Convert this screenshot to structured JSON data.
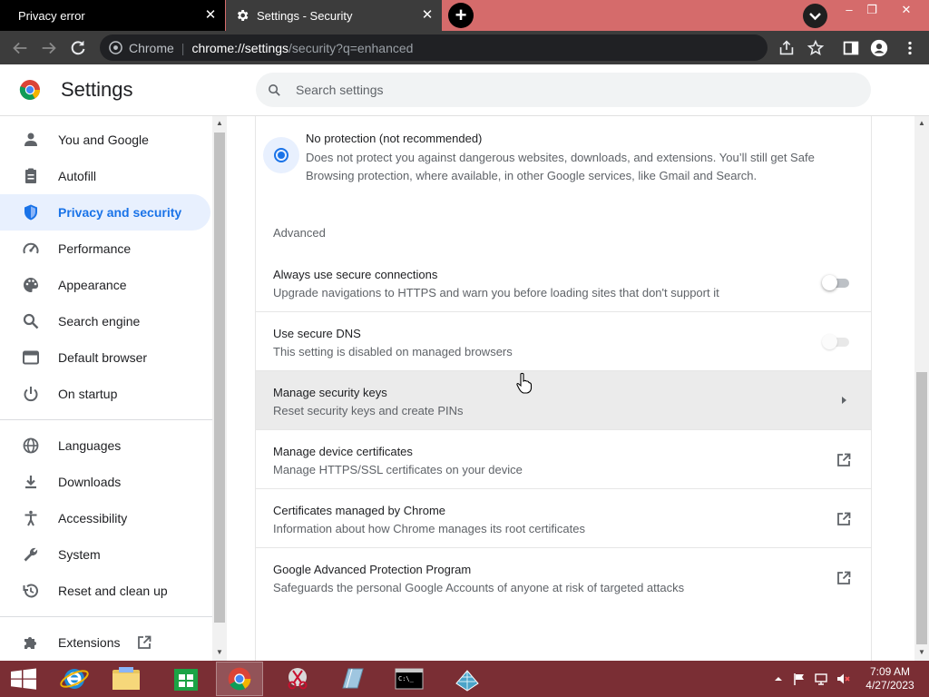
{
  "browser": {
    "tabs": [
      {
        "title": "Privacy error",
        "active": false
      },
      {
        "title": "Settings - Security",
        "active": true
      }
    ],
    "omnibox": {
      "chip": "Chrome",
      "url_host": "chrome://settings",
      "url_path": "/security?q=enhanced"
    },
    "window_controls": {
      "minimize": "–",
      "restore": "❐",
      "close": "✕"
    },
    "new_tab": "+",
    "tab_close": "✕"
  },
  "settings": {
    "title": "Settings",
    "search": {
      "placeholder": "Search settings",
      "value": ""
    }
  },
  "sidebar": {
    "items": [
      {
        "label": "You and Google",
        "icon": "person-icon"
      },
      {
        "label": "Autofill",
        "icon": "clipboard-icon"
      },
      {
        "label": "Privacy and security",
        "icon": "shield-icon",
        "selected": true
      },
      {
        "label": "Performance",
        "icon": "speedometer-icon"
      },
      {
        "label": "Appearance",
        "icon": "palette-icon"
      },
      {
        "label": "Search engine",
        "icon": "search-icon"
      },
      {
        "label": "Default browser",
        "icon": "browser-window-icon"
      },
      {
        "label": "On startup",
        "icon": "power-icon"
      },
      {
        "label": "Languages",
        "icon": "globe-icon"
      },
      {
        "label": "Downloads",
        "icon": "download-icon"
      },
      {
        "label": "Accessibility",
        "icon": "accessibility-icon"
      },
      {
        "label": "System",
        "icon": "wrench-icon"
      },
      {
        "label": "Reset and clean up",
        "icon": "history-icon"
      },
      {
        "label": "Extensions",
        "icon": "puzzle-icon"
      }
    ]
  },
  "content": {
    "no_protection": {
      "title": "No protection (not recommended)",
      "description": "Does not protect you against dangerous websites, downloads, and extensions. You’ll still get Safe Browsing protection, where available, in other Google services, like Gmail and Search.",
      "selected": true
    },
    "advanced_label": "Advanced",
    "rows": [
      {
        "title": "Always use secure connections",
        "subtitle": "Upgrade navigations to HTTPS and warn you before loading sites that don't support it",
        "control": "toggle",
        "enabled": false,
        "disabled": false
      },
      {
        "title": "Use secure DNS",
        "subtitle": "This setting is disabled on managed browsers",
        "control": "toggle",
        "enabled": false,
        "disabled": true
      },
      {
        "title": "Manage security keys",
        "subtitle": "Reset security keys and create PINs",
        "control": "arrow"
      },
      {
        "title": "Manage device certificates",
        "subtitle": "Manage HTTPS/SSL certificates on your device",
        "control": "external"
      },
      {
        "title": "Certificates managed by Chrome",
        "subtitle": "Information about how Chrome manages its root certificates",
        "control": "external"
      },
      {
        "title": "Google Advanced Protection Program",
        "subtitle": "Safeguards the personal Google Accounts of anyone at risk of targeted attacks",
        "control": "external"
      }
    ]
  },
  "taskbar": {
    "time": "7:09 AM",
    "date": "4/27/2023",
    "apps": [
      "windows-start",
      "internet-explorer",
      "file-explorer",
      "store",
      "chrome",
      "snipping-tool",
      "notepad",
      "command-prompt",
      "network-app"
    ]
  },
  "colors": {
    "accent": "#1a73e8",
    "tabstrip": "#d56b6b",
    "taskbar": "#7a2e34",
    "toolbar": "#3c3c3c"
  }
}
